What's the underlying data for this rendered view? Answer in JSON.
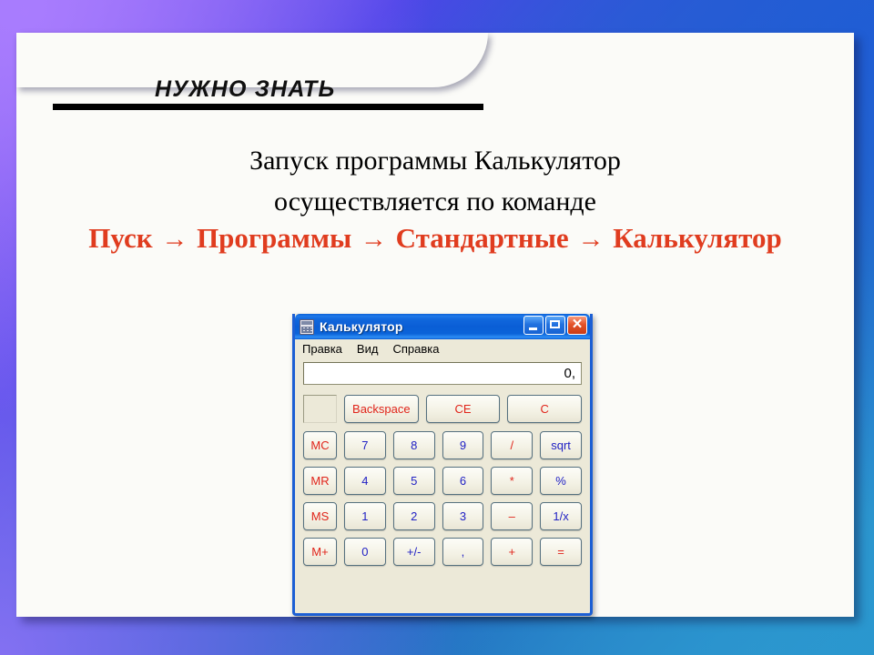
{
  "slide": {
    "header_title": "НУЖНО ЗНАТЬ",
    "body_line_1": "Запуск программы Калькулятор",
    "body_line_2": "осуществляется по команде",
    "path": {
      "step_1": "Пуск",
      "arrow_1": "→",
      "step_2": "Программы",
      "arrow_2": "→",
      "step_3": "Стандартные",
      "arrow_3": "→",
      "step_4": "Калькулятор"
    },
    "colors": {
      "path_red": "#e03c1f",
      "body_black": "#000000",
      "panel_white": "#fbfbf8",
      "bg_purple": "#9a74f2",
      "bg_blue": "#2563c4",
      "bg_cyan_blue": "#3a9fd4"
    }
  },
  "calculator": {
    "title": "Калькулятор",
    "icon": "calculator-icon",
    "window_buttons": [
      {
        "name": "minimize",
        "label": "_"
      },
      {
        "name": "maximize",
        "label": "□"
      },
      {
        "name": "close",
        "label": "×"
      }
    ],
    "menu": [
      "Правка",
      "Вид",
      "Справка"
    ],
    "display_value": "0,",
    "memory_indicator": "",
    "top_row": [
      {
        "label": "Backspace",
        "color": "red"
      },
      {
        "label": "CE",
        "color": "red"
      },
      {
        "label": "C",
        "color": "red"
      }
    ],
    "keypad": [
      [
        {
          "label": "MC",
          "color": "red"
        },
        {
          "label": "7",
          "color": "blue"
        },
        {
          "label": "8",
          "color": "blue"
        },
        {
          "label": "9",
          "color": "blue"
        },
        {
          "label": "/",
          "color": "red"
        },
        {
          "label": "sqrt",
          "color": "blue"
        }
      ],
      [
        {
          "label": "MR",
          "color": "red"
        },
        {
          "label": "4",
          "color": "blue"
        },
        {
          "label": "5",
          "color": "blue"
        },
        {
          "label": "6",
          "color": "blue"
        },
        {
          "label": "*",
          "color": "red"
        },
        {
          "label": "%",
          "color": "blue"
        }
      ],
      [
        {
          "label": "MS",
          "color": "red"
        },
        {
          "label": "1",
          "color": "blue"
        },
        {
          "label": "2",
          "color": "blue"
        },
        {
          "label": "3",
          "color": "blue"
        },
        {
          "label": "–",
          "color": "red"
        },
        {
          "label": "1/x",
          "color": "blue"
        }
      ],
      [
        {
          "label": "M+",
          "color": "red"
        },
        {
          "label": "0",
          "color": "blue"
        },
        {
          "label": "+/-",
          "color": "blue"
        },
        {
          "label": ",",
          "color": "blue"
        },
        {
          "label": "+",
          "color": "red"
        },
        {
          "label": "=",
          "color": "red"
        }
      ]
    ]
  }
}
